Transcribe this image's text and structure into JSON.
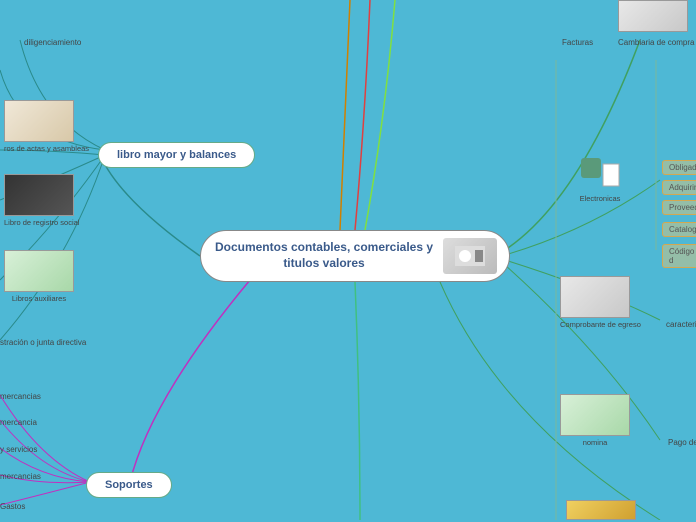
{
  "central": {
    "title": "Documentos contables, comerciales y titulos valores"
  },
  "branches": {
    "libro": {
      "label": "libro mayor y balances"
    },
    "soportes": {
      "label": "Soportes"
    }
  },
  "leaves": {
    "diligenciamiento": "diligenciamiento",
    "actas": "ros de actas y asambleas",
    "registro": "Libro de registro social",
    "auxiliares": "Libros auxiliares",
    "junta": "stración o junta directiva",
    "mercancias1": "mercancias",
    "mercancia": "mercancia",
    "yservicios": "y servicios",
    "mercancias2": "mercancias",
    "gastos": "Gastos",
    "facturas": "Facturas",
    "cambiaria": "Cambiaria de compra y ven",
    "electronicas": "Electronicas",
    "obligado": "Obligado",
    "adquirir": "Adquirir",
    "proveedor": "Proveedo",
    "catalogo": "Catalogo",
    "codigo": "Código d",
    "comprobante": "Comprobante de egreso",
    "caracteri": "caracteri",
    "nomina": "nomina",
    "pagode": "Pago de"
  }
}
